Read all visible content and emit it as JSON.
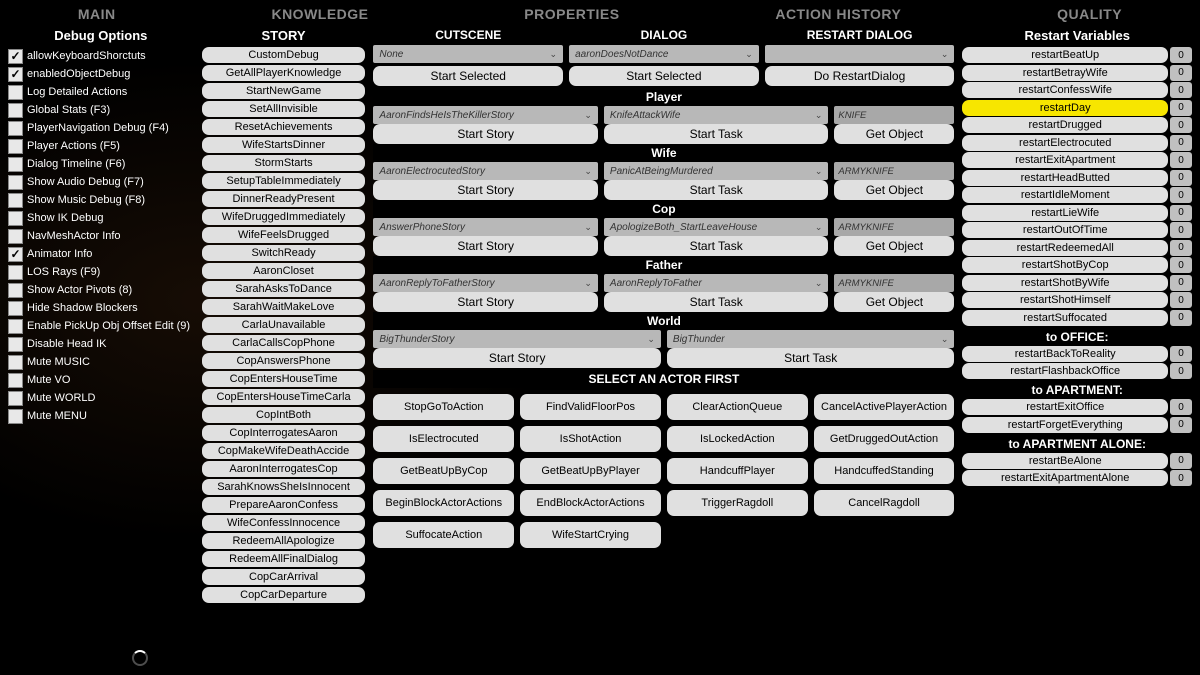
{
  "nav": {
    "items": [
      "MAIN",
      "KNOWLEDGE",
      "PROPERTIES",
      "ACTION HISTORY",
      "QUALITY"
    ]
  },
  "debug": {
    "title": "Debug Options",
    "items": [
      {
        "label": "allowKeyboardShorctuts",
        "checked": true
      },
      {
        "label": "enabledObjectDebug",
        "checked": true
      },
      {
        "label": "Log Detailed Actions",
        "checked": false
      },
      {
        "label": "Global Stats (F3)",
        "checked": false
      },
      {
        "label": "PlayerNavigation Debug (F4)",
        "checked": false
      },
      {
        "label": "Player Actions (F5)",
        "checked": false
      },
      {
        "label": "Dialog Timeline (F6)",
        "checked": false
      },
      {
        "label": "Show Audio Debug (F7)",
        "checked": false
      },
      {
        "label": "Show Music Debug (F8)",
        "checked": false
      },
      {
        "label": "Show IK Debug",
        "checked": false
      },
      {
        "label": "NavMeshActor Info",
        "checked": false
      },
      {
        "label": "Animator Info",
        "checked": true
      },
      {
        "label": "LOS Rays (F9)",
        "checked": false
      },
      {
        "label": "Show Actor Pivots (8)",
        "checked": false
      },
      {
        "label": "Hide Shadow Blockers",
        "checked": false
      },
      {
        "label": "Enable PickUp Obj Offset Edit (9)",
        "checked": false
      },
      {
        "label": "Disable Head IK",
        "checked": false
      },
      {
        "label": "Mute MUSIC",
        "checked": false
      },
      {
        "label": "Mute VO",
        "checked": false
      },
      {
        "label": "Mute WORLD",
        "checked": false
      },
      {
        "label": "Mute MENU",
        "checked": false
      }
    ]
  },
  "story": {
    "title": "STORY",
    "items": [
      "CustomDebug",
      "GetAllPlayerKnowledge",
      "StartNewGame",
      "SetAllInvisible",
      "ResetAchievements",
      "WifeStartsDinner",
      "StormStarts",
      "SetupTableImmediately",
      "DinnerReadyPresent",
      "WifeDruggedImmediately",
      "WifeFeelsDrugged",
      "SwitchReady",
      "AaronCloset",
      "SarahAsksToDance",
      "SarahWaitMakeLove",
      "CarlaUnavailable",
      "CarlaCallsCopPhone",
      "CopAnswersPhone",
      "CopEntersHouseTime",
      "CopEntersHouseTimeCarla",
      "CopIntBoth",
      "CopInterrogatesAaron",
      "CopMakeWifeDeathAccide",
      "AaronInterrogatesCop",
      "SarahKnowsSheIsInnocent",
      "PrepareAaronConfess",
      "WifeConfessInnocence",
      "RedeemAllApologize",
      "RedeemAllFinalDialog",
      "CopCarArrival",
      "CopCarDeparture"
    ]
  },
  "center": {
    "cutscene": {
      "label": "CUTSCENE",
      "value": "None",
      "button": "Start Selected"
    },
    "dialog": {
      "label": "DIALOG",
      "value": "aaronDoesNotDance",
      "button": "Start Selected"
    },
    "restartDialog": {
      "label": "RESTART DIALOG",
      "value": "",
      "button": "Do RestartDialog"
    },
    "actors": [
      {
        "name": "Player",
        "story": "AaronFindsHeIsTheKillerStory",
        "task": "KnifeAttackWife",
        "obj": "KNIFE",
        "has_obj": true
      },
      {
        "name": "Wife",
        "story": "AaronElectrocutedStory",
        "task": "PanicAtBeingMurdered",
        "obj": "ARMYKNIFE",
        "has_obj": true
      },
      {
        "name": "Cop",
        "story": "AnswerPhoneStory",
        "task": "ApologizeBoth_StartLeaveHouse",
        "obj": "ARMYKNIFE",
        "has_obj": true
      },
      {
        "name": "Father",
        "story": "AaronReplyToFatherStory",
        "task": "AaronReplyToFather",
        "obj": "ARMYKNIFE",
        "has_obj": true
      },
      {
        "name": "World",
        "story": "BigThunderStory",
        "task": "BigThunder",
        "obj": "",
        "has_obj": false
      }
    ],
    "actor_buttons": {
      "start_story": "Start Story",
      "start_task": "Start Task",
      "get_object": "Get Object"
    },
    "actions_title": "SELECT AN ACTOR FIRST",
    "actions": [
      "StopGoToAction",
      "FindValidFloorPos",
      "ClearActionQueue",
      "CancelActivePlayerAction",
      "IsElectrocuted",
      "IsShotAction",
      "IsLockedAction",
      "GetDruggedOutAction",
      "GetBeatUpByCop",
      "GetBeatUpByPlayer",
      "HandcuffPlayer",
      "HandcuffedStanding",
      "BeginBlockActorActions",
      "EndBlockActorActions",
      "TriggerRagdoll",
      "CancelRagdoll",
      "SuffocateAction",
      "WifeStartCrying"
    ]
  },
  "restart": {
    "title": "Restart Variables",
    "main": [
      {
        "label": "restartBeatUp",
        "val": "0",
        "active": false
      },
      {
        "label": "restartBetrayWife",
        "val": "0",
        "active": false
      },
      {
        "label": "restartConfessWife",
        "val": "0",
        "active": false
      },
      {
        "label": "restartDay",
        "val": "0",
        "active": true
      },
      {
        "label": "restartDrugged",
        "val": "0",
        "active": false
      },
      {
        "label": "restartElectrocuted",
        "val": "0",
        "active": false
      },
      {
        "label": "restartExitApartment",
        "val": "0",
        "active": false
      },
      {
        "label": "restartHeadButted",
        "val": "0",
        "active": false
      },
      {
        "label": "restartIdleMoment",
        "val": "0",
        "active": false
      },
      {
        "label": "restartLieWife",
        "val": "0",
        "active": false
      },
      {
        "label": "restartOutOfTime",
        "val": "0",
        "active": false
      },
      {
        "label": "restartRedeemedAll",
        "val": "0",
        "active": false
      },
      {
        "label": "restartShotByCop",
        "val": "0",
        "active": false
      },
      {
        "label": "restartShotByWife",
        "val": "0",
        "active": false
      },
      {
        "label": "restartShotHimself",
        "val": "0",
        "active": false
      },
      {
        "label": "restartSuffocated",
        "val": "0",
        "active": false
      }
    ],
    "groups": [
      {
        "title": "to OFFICE:",
        "items": [
          {
            "label": "restartBackToReality",
            "val": "0"
          },
          {
            "label": "restartFlashbackOffice",
            "val": "0"
          }
        ]
      },
      {
        "title": "to APARTMENT:",
        "items": [
          {
            "label": "restartExitOffice",
            "val": "0"
          },
          {
            "label": "restartForgetEverything",
            "val": "0"
          }
        ]
      },
      {
        "title": "to APARTMENT ALONE:",
        "items": [
          {
            "label": "restartBeAlone",
            "val": "0"
          },
          {
            "label": "restartExitApartmentAlone",
            "val": "0"
          }
        ]
      }
    ]
  }
}
